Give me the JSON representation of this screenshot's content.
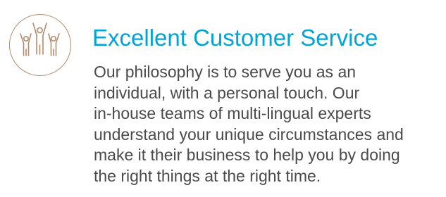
{
  "feature": {
    "icon": "people-celebrating-icon",
    "accent_color": "#00a4d6",
    "icon_color": "#b38b6d",
    "text_color": "#4a4a4a",
    "title": "Excellent Customer Service",
    "body_lines": [
      "Our philosophy is to serve you as an",
      "individual, with a personal touch. Our",
      "in-house teams of multi-lingual experts",
      "understand your unique circumstances and",
      "make it their business to help you by doing",
      "the right things at the right time."
    ]
  }
}
